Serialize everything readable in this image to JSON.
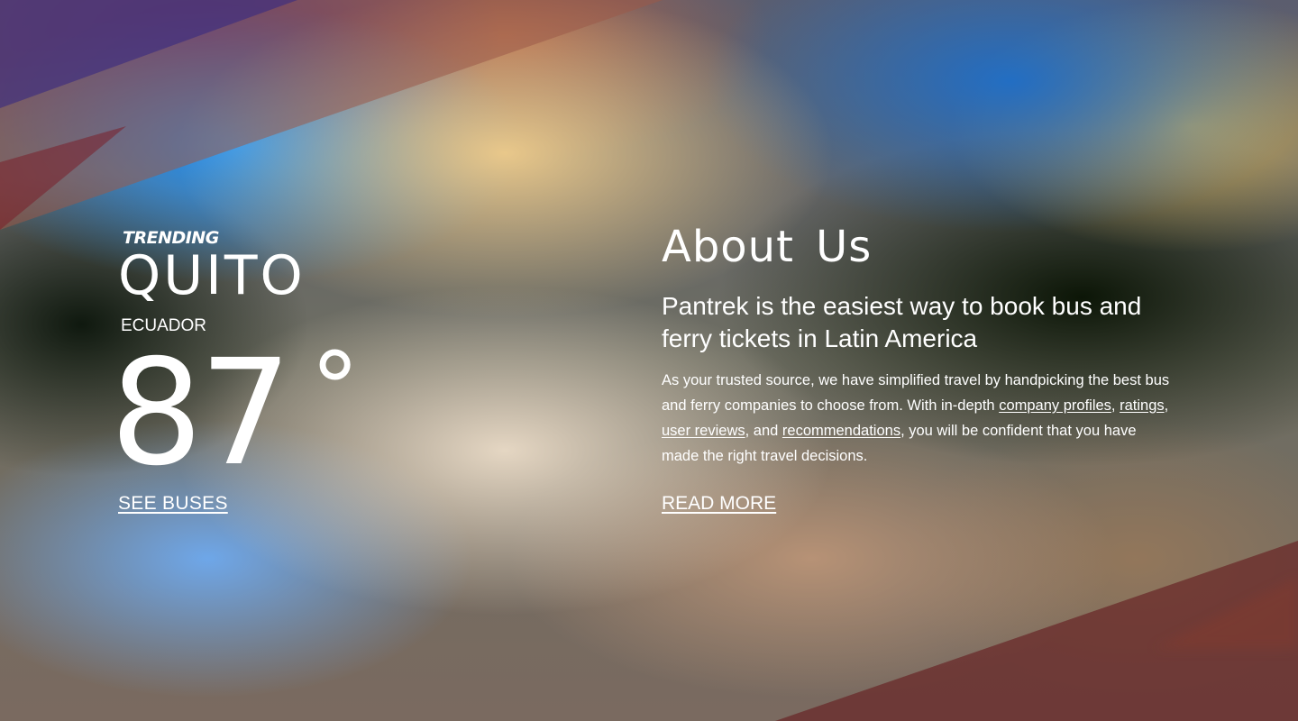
{
  "trending": {
    "label": "TRENDING",
    "city": "QUITO",
    "country": "ECUADOR",
    "temperature": "87",
    "degree_symbol": "°",
    "cta_label": "SEE BUSES"
  },
  "about": {
    "title": "About Us",
    "subtitle": "Pantrek is the easiest way to book bus and ferry tickets in Latin America",
    "body_part1": "As your trusted source, we have simplified travel by handpicking the best bus and ferry companies to choose from. With in-depth ",
    "link_company_profiles": "company profiles",
    "sep1": ", ",
    "link_ratings": "ratings",
    "sep2": ", ",
    "link_user_reviews": "user reviews",
    "sep3": ", and ",
    "link_recommendations": "recommendations",
    "body_part2": ", you will be confident that you have made the right travel decisions.",
    "cta_label": "READ MORE"
  },
  "colors": {
    "text": "#ffffff",
    "streak_top": "#a85a3c",
    "streak_bottom": "#6a2a2a"
  }
}
